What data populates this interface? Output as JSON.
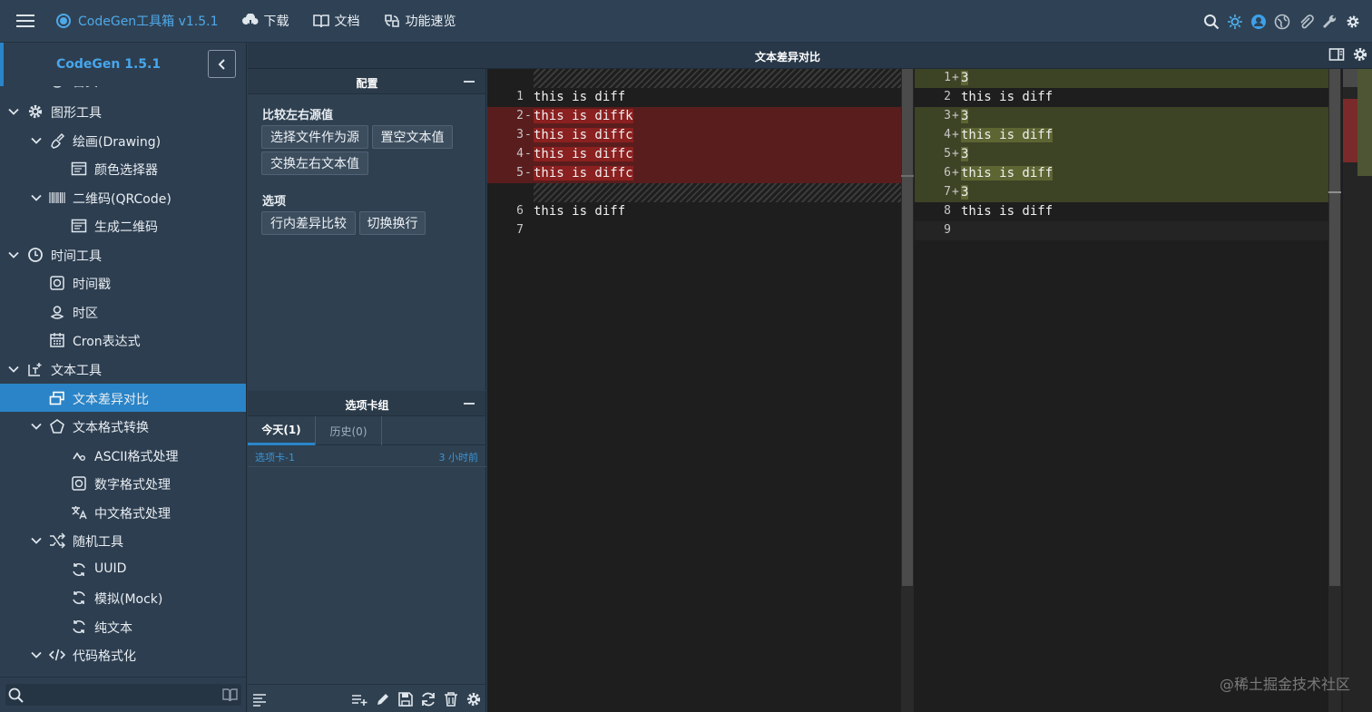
{
  "topbar": {
    "app_title": "CodeGen工具箱 v1.5.1",
    "nav": [
      {
        "label": "下载",
        "icon": "download-cloud-icon"
      },
      {
        "label": "文档",
        "icon": "book-icon"
      },
      {
        "label": "功能速览",
        "icon": "overview-icon"
      }
    ],
    "right_icons": [
      "search-icon",
      "theme-sun-icon",
      "user-icon",
      "globe-icon",
      "attachment-icon",
      "wrench-icon",
      "gear-icon"
    ]
  },
  "sidebar": {
    "version": "CodeGen 1.5.1",
    "partial_top": "首页",
    "items": [
      {
        "label": "图形工具",
        "level": 0,
        "expanded": true,
        "icon": "gear-icon"
      },
      {
        "label": "绘画(Drawing)",
        "level": 1,
        "expanded": true,
        "icon": "brush-icon"
      },
      {
        "label": "颜色选择器",
        "level": 2,
        "icon": "window-icon"
      },
      {
        "label": "二维码(QRCode)",
        "level": 1,
        "expanded": true,
        "icon": "barcode-icon"
      },
      {
        "label": "生成二维码",
        "level": 2,
        "icon": "window-icon"
      },
      {
        "label": "时间工具",
        "level": 0,
        "expanded": true,
        "icon": "clock-icon"
      },
      {
        "label": "时间戳",
        "level": 1,
        "icon": "frame-icon"
      },
      {
        "label": "时区",
        "level": 1,
        "icon": "location-icon"
      },
      {
        "label": "Cron表达式",
        "level": 1,
        "icon": "calendar-icon"
      },
      {
        "label": "文本工具",
        "level": 0,
        "expanded": true,
        "icon": "text-tool-icon"
      },
      {
        "label": "文本差异对比",
        "level": 1,
        "active": true,
        "icon": "diff-icon"
      },
      {
        "label": "文本格式转换",
        "level": 1,
        "expanded": true,
        "icon": "pentagon-icon"
      },
      {
        "label": "ASCII格式处理",
        "level": 2,
        "icon": "ascii-icon"
      },
      {
        "label": "数字格式处理",
        "level": 2,
        "icon": "frame-icon"
      },
      {
        "label": "中文格式处理",
        "level": 2,
        "icon": "translate-icon"
      },
      {
        "label": "随机工具",
        "level": 1,
        "expanded": true,
        "icon": "shuffle-icon"
      },
      {
        "label": "UUID",
        "level": 2,
        "icon": "refresh-icon"
      },
      {
        "label": "模拟(Mock)",
        "level": 2,
        "icon": "refresh-icon"
      },
      {
        "label": "纯文本",
        "level": 2,
        "icon": "refresh-icon"
      },
      {
        "label": "代码格式化",
        "level": 1,
        "expanded": true,
        "icon": "code-icon"
      }
    ],
    "search_placeholder": ""
  },
  "main": {
    "title": "文本差异对比"
  },
  "config": {
    "header": "配置",
    "group1_label": "比较左右源值",
    "buttons1": [
      "选择文件作为源",
      "置空文本值",
      "交换左右文本值"
    ],
    "group2_label": "选项",
    "buttons2": [
      "行内差异比较",
      "切换换行"
    ]
  },
  "tab_group": {
    "header": "选项卡组",
    "tabs": [
      {
        "label": "今天(1)",
        "active": true
      },
      {
        "label": "历史(0)",
        "active": false
      }
    ],
    "items": [
      {
        "name": "选项卡-1",
        "time": "3 小时前"
      }
    ]
  },
  "bottom_toolbar_icons": [
    "lines-icon",
    "add-list-icon",
    "pencil-icon",
    "save-icon",
    "refresh-icon",
    "trash-icon",
    "gear-icon"
  ],
  "diff": {
    "left": [
      {
        "num": "",
        "type": "placeholder"
      },
      {
        "num": "1",
        "marker": "",
        "text": "this is diff",
        "type": "same"
      },
      {
        "num": "2",
        "marker": "-",
        "text": "this is diffk",
        "type": "removed"
      },
      {
        "num": "3",
        "marker": "-",
        "text": "this is diffc",
        "type": "removed"
      },
      {
        "num": "4",
        "marker": "-",
        "text": "this is diffc",
        "type": "removed"
      },
      {
        "num": "5",
        "marker": "-",
        "text": "this is diffc",
        "type": "removed"
      },
      {
        "num": "",
        "type": "placeholder"
      },
      {
        "num": "6",
        "marker": "",
        "text": "this is diff",
        "type": "same"
      },
      {
        "num": "7",
        "marker": "",
        "text": "",
        "type": "same"
      }
    ],
    "right": [
      {
        "num": "1",
        "marker": "+",
        "text": "3",
        "type": "added"
      },
      {
        "num": "2",
        "marker": "",
        "text": "this is diff",
        "type": "same"
      },
      {
        "num": "3",
        "marker": "+",
        "text": "3",
        "type": "added"
      },
      {
        "num": "4",
        "marker": "+",
        "text": "this is diff",
        "type": "added"
      },
      {
        "num": "5",
        "marker": "+",
        "text": "3",
        "type": "added"
      },
      {
        "num": "6",
        "marker": "+",
        "text": "this is diff",
        "type": "added"
      },
      {
        "num": "7",
        "marker": "+",
        "text": "3",
        "type": "added"
      },
      {
        "num": "8",
        "marker": "",
        "text": "this is diff",
        "type": "same"
      },
      {
        "num": "9",
        "marker": "",
        "text": "",
        "type": "same"
      }
    ],
    "removed_bg": "#5a1d1d",
    "removed_text_bg": "#8b2020",
    "added_bg": "#3d4325",
    "added_text_bg": "#5d6633"
  },
  "watermark": "@稀土掘金技术社区",
  "colors": {
    "accent": "#2a85c9",
    "brand": "#4fa9ea"
  }
}
